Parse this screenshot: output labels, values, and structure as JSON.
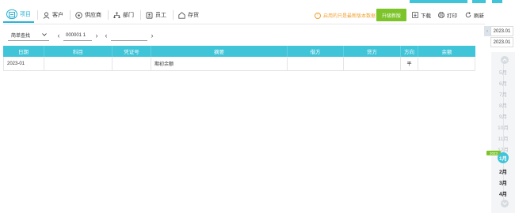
{
  "tabs": [
    {
      "label": "项目",
      "icon": "project-icon",
      "active": true
    },
    {
      "label": "客户",
      "icon": "customer-icon"
    },
    {
      "label": "供应商",
      "icon": "supplier-icon"
    },
    {
      "label": "部门",
      "icon": "department-icon"
    },
    {
      "label": "员工",
      "icon": "employee-icon"
    },
    {
      "label": "存货",
      "icon": "inventory-icon"
    }
  ],
  "header": {
    "notice": "启用的只是最新版本数据",
    "upgrade_label": "升级新版",
    "download_label": "下载",
    "print_label": "打印",
    "refresh_label": "刷新"
  },
  "filters": {
    "mode_select": "简单查找",
    "code_value": "000001 1",
    "name_value": ""
  },
  "table": {
    "columns": [
      "日期",
      "科目",
      "凭证号",
      "摘要",
      "借方",
      "贷方",
      "方向",
      "余额"
    ],
    "rows": [
      [
        "2023-01",
        "",
        "",
        "期初余额",
        "",
        "",
        "平",
        ""
      ]
    ]
  },
  "period": {
    "start": "2023.01",
    "end": "2023.01",
    "year_badge": "2023",
    "months_faded": [
      "5月",
      "6月",
      "7月",
      "8月",
      "9月",
      "10月",
      "11月",
      "12月"
    ],
    "current_month": "1月",
    "months_next": [
      "2月",
      "3月",
      "4月"
    ]
  },
  "colors": {
    "accent": "#40c4d8",
    "upgrade": "#7cc42a",
    "notice": "#f0a030"
  }
}
